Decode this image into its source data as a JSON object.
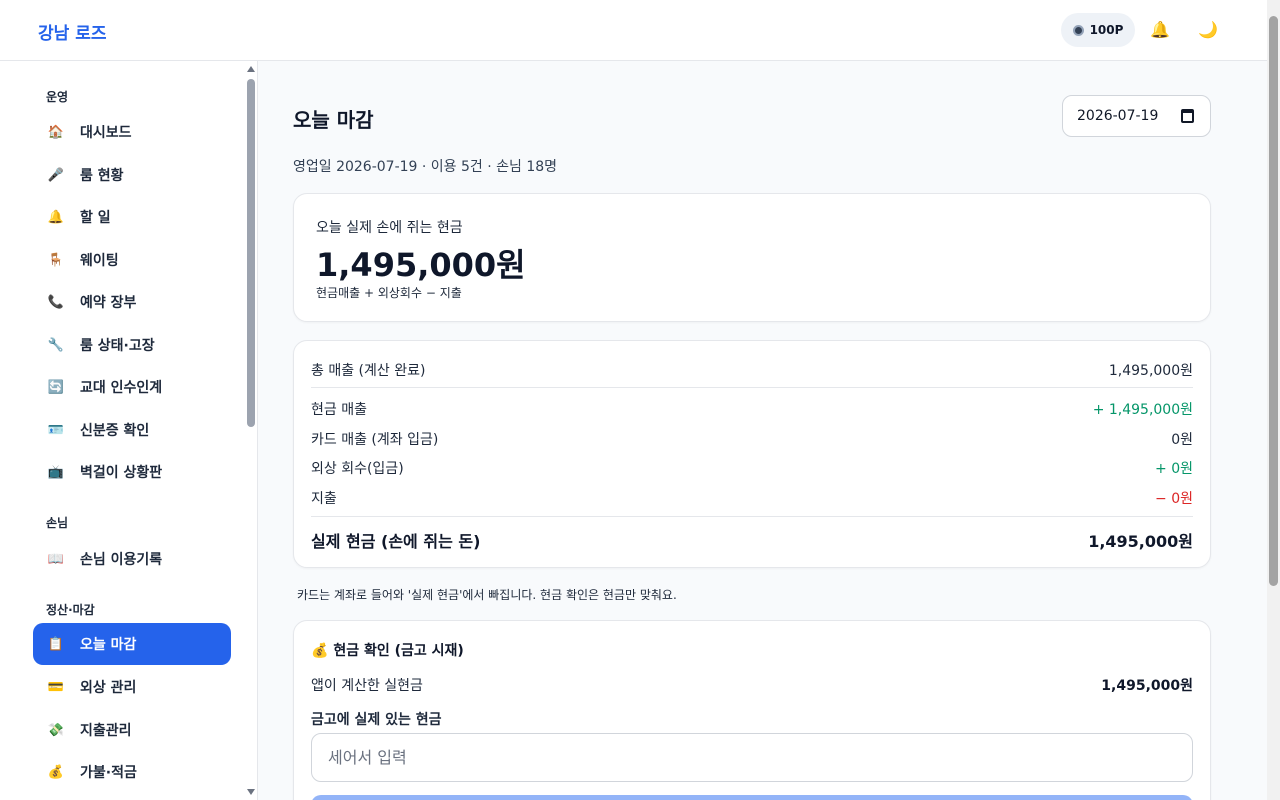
{
  "app": {
    "brand": "강남 로즈"
  },
  "header": {
    "points": "100P",
    "points_icon": "coin-icon",
    "bell_icon": "bell-icon",
    "theme_icon": "moon-icon"
  },
  "sidebar": {
    "sections": [
      {
        "title": "운영",
        "items": [
          {
            "icon": "🏠",
            "label": "대시보드"
          },
          {
            "icon": "🎤",
            "label": "룸 현황"
          },
          {
            "icon": "🔔",
            "label": "할 일"
          },
          {
            "icon": "🪑",
            "label": "웨이팅"
          },
          {
            "icon": "📞",
            "label": "예약 장부"
          },
          {
            "icon": "🔧",
            "label": "룸 상태·고장"
          },
          {
            "icon": "🔄",
            "label": "교대 인수인계"
          },
          {
            "icon": "🪪",
            "label": "신분증 확인"
          },
          {
            "icon": "📺",
            "label": "벽걸이 상황판"
          }
        ]
      },
      {
        "title": "손님",
        "items": [
          {
            "icon": "📖",
            "label": "손님 이용기록"
          }
        ]
      },
      {
        "title": "정산·마감",
        "items": [
          {
            "icon": "📋",
            "label": "오늘 마감",
            "active": true
          },
          {
            "icon": "💳",
            "label": "외상 관리"
          },
          {
            "icon": "💸",
            "label": "지출관리"
          },
          {
            "icon": "💰",
            "label": "가불·적금"
          }
        ]
      }
    ]
  },
  "main": {
    "title": "오늘 마감",
    "date_value": "2026-07-19",
    "subline": "영업일 2026-07-19 · 이용 5건 · 손님 18명",
    "cash_card": {
      "label": "오늘 실제 손에 쥐는 현금",
      "amount": "1,495,000원",
      "formula": "현금매출 + 외상회수 − 지출"
    },
    "breakdown": {
      "total_sales": {
        "label": "총 매출 (계산 완료)",
        "value": "1,495,000원"
      },
      "rows": [
        {
          "label": "현금 매출",
          "value": "+ 1,495,000원",
          "tone": "pos"
        },
        {
          "label": "카드 매출 (계좌 입금)",
          "value": "0원",
          "tone": "neutral"
        },
        {
          "label": "외상 회수(입금)",
          "value": "+ 0원",
          "tone": "pos"
        },
        {
          "label": "지출",
          "value": "− 0원",
          "tone": "neg"
        }
      ],
      "real_cash": {
        "label": "실제 현금 (손에 쥐는 돈)",
        "value": "1,495,000원"
      }
    },
    "note": "카드는 계좌로 들어와 '실제 현금'에서 빠집니다. 현금 확인은 현금만 맞춰요.",
    "cash_check": {
      "icon": "💰",
      "title": "현금 확인 (금고 시재)",
      "app_calc_label": "앱이 계산한 실현금",
      "app_calc_value": "1,495,000원",
      "safe_label": "금고에 실제 있는 현금",
      "input_value": "",
      "input_placeholder": "세어서 입력"
    }
  },
  "colors": {
    "accent": "#2563eb",
    "positive": "#059669",
    "negative": "#dc2626"
  }
}
